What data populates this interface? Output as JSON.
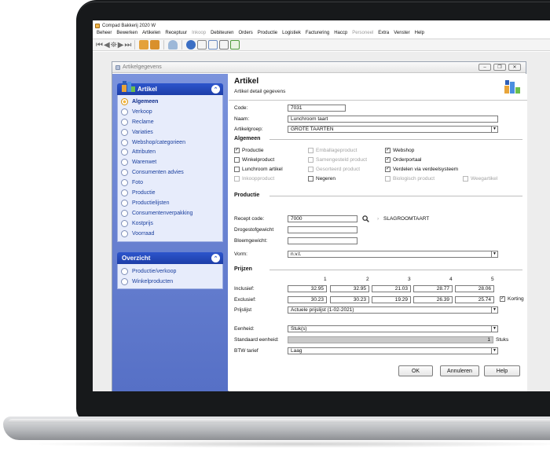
{
  "app": {
    "title": "Compad Bakkerij 2020 W"
  },
  "menu": [
    "Beheer",
    "Bewerken",
    "Artikelen",
    "Receptuur",
    "Inkoop",
    "Debiteuren",
    "Orders",
    "Productie",
    "Logistiek",
    "Facturering",
    "Haccp",
    "Personeel",
    "Extra",
    "Venster",
    "Help"
  ],
  "menu_disabled": [
    "Inkoop",
    "Personeel"
  ],
  "window": {
    "title": "Artikelgegevens",
    "buttons": [
      "minimize",
      "restore",
      "close"
    ]
  },
  "nav": {
    "artikel_header": "Artikel",
    "artikel_items": [
      "Algemeen",
      "Verkoop",
      "Reclame",
      "Variaties",
      "Webshop/categorieen",
      "Attributen",
      "Warenwet",
      "Consumenten advies",
      "Foto",
      "Productie",
      "Productielijsten",
      "Consumentenverpakking",
      "Kostprijs",
      "Voorraad"
    ],
    "active": "Algemeen",
    "overzicht_header": "Overzicht",
    "overzicht_items": [
      "Productie/verkoop",
      "Winkelproducten"
    ]
  },
  "content": {
    "title": "Artikel",
    "subtitle": "Artikel detail gegevens",
    "code_label": "Code:",
    "code_value": "7031",
    "naam_label": "Naam:",
    "naam_value": "Lunchroom taart",
    "groep_label": "Artikelgroep:",
    "groep_value": "GROTE TAARTEN"
  },
  "algemeen": {
    "title": "Algemeen",
    "checkboxes": [
      {
        "label": "Productie",
        "checked": true,
        "enabled": true
      },
      {
        "label": "Winkelproduct",
        "checked": false,
        "enabled": true
      },
      {
        "label": "Lunchroom artikel",
        "checked": false,
        "enabled": true
      },
      {
        "label": "Inkoopproduct",
        "checked": false,
        "enabled": false
      },
      {
        "label": "Emballageproduct",
        "checked": false,
        "enabled": false
      },
      {
        "label": "Samengesteld product",
        "checked": false,
        "enabled": false
      },
      {
        "label": "Gesorteerd product",
        "checked": false,
        "enabled": false
      },
      {
        "label": "Negeren",
        "checked": false,
        "enabled": true
      },
      {
        "label": "Webshop",
        "checked": true,
        "enabled": true
      },
      {
        "label": "Orderportaal",
        "checked": true,
        "enabled": true
      },
      {
        "label": "Verdelen via verdeelsysteem",
        "checked": true,
        "enabled": true
      },
      {
        "label": "Biologisch product",
        "checked": false,
        "enabled": false
      },
      {
        "label": "Weegartikel",
        "checked": false,
        "enabled": false
      }
    ]
  },
  "productie": {
    "title": "Productie",
    "recept_label": "Recept code:",
    "recept_value": "7000",
    "recept_name": "SLAGROOMTAART",
    "droge_label": "Drogestofgewicht",
    "droge_value": "",
    "bloem_label": "Bloemgewicht:",
    "bloem_value": "",
    "vorm_label": "Vorm:",
    "vorm_value": "n.v.t."
  },
  "prijzen": {
    "title": "Prijzen",
    "columns": [
      "1",
      "2",
      "3",
      "4",
      "5"
    ],
    "inclusief_label": "Inclusief:",
    "inclusief": [
      "32.95",
      "32.95",
      "21.03",
      "28.77",
      "28.06"
    ],
    "exclusief_label": "Exclusief:",
    "exclusief": [
      "30.23",
      "30.23",
      "19.29",
      "26.39",
      "25.74"
    ],
    "korting_label": "Korting",
    "korting_checked": true,
    "prijslijst_label": "Prijslijst",
    "prijslijst_value": "Actuele prijslijst (1-02-2021)",
    "eenheid_label": "Eenheid:",
    "eenheid_value": "Stuk(s)",
    "standaard_label": "Standaard eenheid:",
    "standaard_value": "1",
    "standaard_unit": "Stuks",
    "btw_label": "BTW tarief",
    "btw_value": "Laag"
  },
  "buttons": {
    "ok": "OK",
    "annuleren": "Annuleren",
    "help": "Help"
  }
}
